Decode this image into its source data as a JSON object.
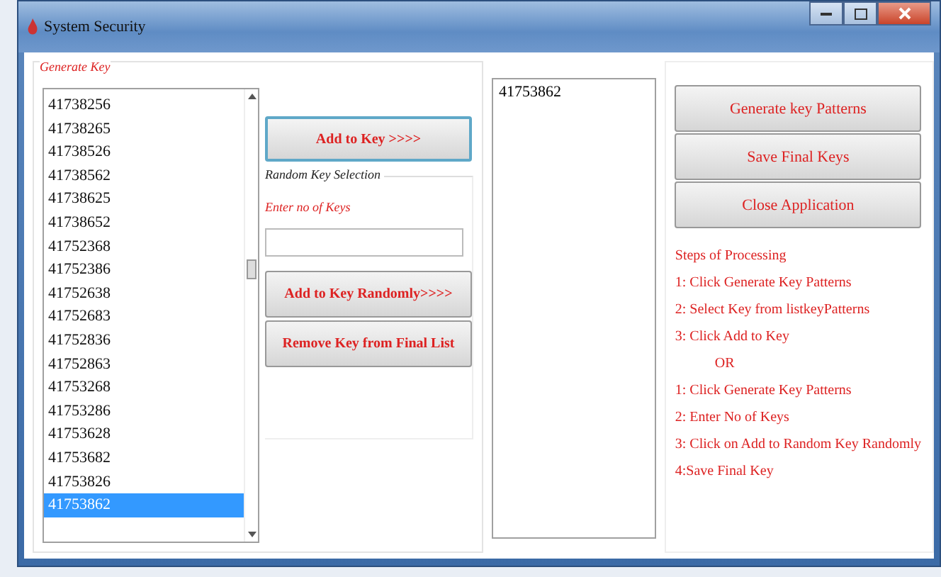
{
  "window": {
    "title": "System Security"
  },
  "generate_group": {
    "title": "Generate Key"
  },
  "key_list": {
    "items": [
      {
        "label": "41738256",
        "selected": false
      },
      {
        "label": "41738265",
        "selected": false
      },
      {
        "label": "41738526",
        "selected": false
      },
      {
        "label": "41738562",
        "selected": false
      },
      {
        "label": "41738625",
        "selected": false
      },
      {
        "label": "41738652",
        "selected": false
      },
      {
        "label": "41752368",
        "selected": false
      },
      {
        "label": "41752386",
        "selected": false
      },
      {
        "label": "41752638",
        "selected": false
      },
      {
        "label": "41752683",
        "selected": false
      },
      {
        "label": "41752836",
        "selected": false
      },
      {
        "label": "41752863",
        "selected": false
      },
      {
        "label": "41753268",
        "selected": false
      },
      {
        "label": "41753286",
        "selected": false
      },
      {
        "label": "41753628",
        "selected": false
      },
      {
        "label": "41753682",
        "selected": false
      },
      {
        "label": "41753826",
        "selected": false
      },
      {
        "label": "41753862",
        "selected": true
      }
    ]
  },
  "add_button": "Add to Key >>>>",
  "random_group": {
    "title": "Random Key Selection",
    "field_label": "Enter no of Keys"
  },
  "random_button": "Add to Key Randomly>>>>",
  "remove_button": "Remove Key from Final List",
  "final_list": {
    "items": [
      "41753862"
    ]
  },
  "actions": [
    "Generate key Patterns",
    "Save Final Keys",
    "Close Application"
  ],
  "steps": {
    "title": "Steps of Processing",
    "lines": [
      {
        "text": "1: Click Generate Key Patterns",
        "kind": "step"
      },
      {
        "text": "2: Select Key from listkeyPatterns",
        "kind": "step"
      },
      {
        "text": "3: Click Add to Key",
        "kind": "step"
      },
      {
        "text": "OR",
        "kind": "separator"
      },
      {
        "text": "1: Click Generate Key Patterns",
        "kind": "step"
      },
      {
        "text": "2: Enter No of Keys",
        "kind": "step"
      },
      {
        "text": "3: Click on Add to Random Key Randomly",
        "kind": "step"
      },
      {
        "text": "4:Save Final Key",
        "kind": "step"
      }
    ]
  }
}
